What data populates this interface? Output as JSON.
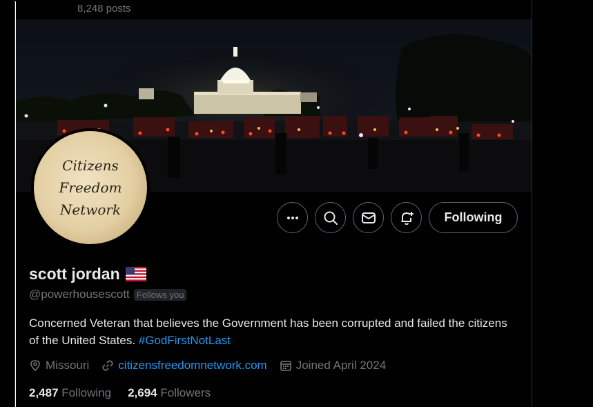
{
  "header": {
    "posts_count": "8,248 posts"
  },
  "profile": {
    "avatar_lines": [
      "Citizens",
      "Freedom",
      "Network"
    ],
    "display_name": "scott jordan",
    "handle": "@powerhousescott",
    "follows_you": "Follows you",
    "bio_text": "Concerned Veteran that believes the Government has been corrupted and failed the citizens of the United States.",
    "bio_hashtag": "#GodFirstNotLast",
    "location": "Missouri",
    "website": "citizensfreedomnetwork.com",
    "joined": "Joined April 2024",
    "following_count": "2,487",
    "following_label": "Following",
    "followers_count": "2,694",
    "followers_label": "Followers"
  },
  "actions": {
    "more_icon": "more-icon",
    "search_icon": "search-icon",
    "message_icon": "mail-icon",
    "notify_icon": "bell-plus-icon",
    "follow_label": "Following"
  },
  "colors": {
    "background": "#000000",
    "text_primary": "#e7e9ea",
    "text_secondary": "#71767b",
    "link": "#1d9bf0",
    "border": "#536471"
  }
}
